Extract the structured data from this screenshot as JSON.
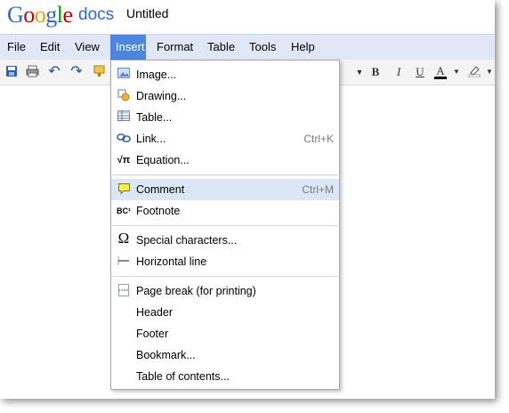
{
  "app": {
    "logo_letters": [
      "G",
      "o",
      "o",
      "g",
      "l",
      "e"
    ],
    "logo_colors": [
      "#3366cc",
      "#cc0000",
      "#e8a000",
      "#3366cc",
      "#009900",
      "#cc0000"
    ],
    "product": "docs",
    "doc_title": "Untitled"
  },
  "menubar": {
    "items": [
      "File",
      "Edit",
      "View",
      "Insert",
      "Format",
      "Table",
      "Tools",
      "Help"
    ],
    "active": "Insert"
  },
  "toolbar": {
    "bold": "B",
    "italic": "I",
    "underline": "U",
    "text_color": "A"
  },
  "insert_menu": {
    "items": [
      {
        "label": "Image...",
        "icon": "image-icon",
        "shortcut": ""
      },
      {
        "label": "Drawing...",
        "icon": "drawing-icon",
        "shortcut": ""
      },
      {
        "label": "Table...",
        "icon": "table-icon",
        "shortcut": ""
      },
      {
        "label": "Link...",
        "icon": "link-icon",
        "shortcut": "Ctrl+K"
      },
      {
        "label": "Equation...",
        "icon": "equation-icon",
        "shortcut": "",
        "icon_text": "√π"
      },
      {
        "label": "Comment",
        "icon": "comment-icon",
        "shortcut": "Ctrl+M",
        "highlighted": true
      },
      {
        "label": "Footnote",
        "icon": "footnote-icon",
        "shortcut": "",
        "icon_text": "BC¹"
      },
      {
        "label": "Special characters...",
        "icon": "omega-icon",
        "shortcut": "",
        "icon_text": "Ω"
      },
      {
        "label": "Horizontal line",
        "icon": "horizontal-line-icon",
        "shortcut": ""
      },
      {
        "label": "Page break (for printing)",
        "icon": "page-break-icon",
        "shortcut": ""
      },
      {
        "label": "Header",
        "icon": "",
        "shortcut": ""
      },
      {
        "label": "Footer",
        "icon": "",
        "shortcut": ""
      },
      {
        "label": "Bookmark...",
        "icon": "",
        "shortcut": ""
      },
      {
        "label": "Table of contents...",
        "icon": "",
        "shortcut": ""
      }
    ]
  }
}
